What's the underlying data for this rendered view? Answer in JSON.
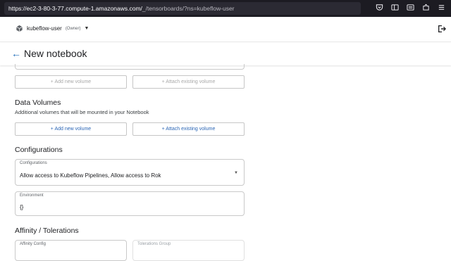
{
  "browser": {
    "url_main": "https://ec2-3-80-3-77.compute-1.amazonaws.com/",
    "url_rest": "_/tensorboards/?ns=kubeflow-user",
    "icons": [
      "pocket-icon",
      "library-icon",
      "reader-icon",
      "extensions-icon",
      "menu-icon"
    ]
  },
  "header": {
    "namespace": "kubeflow-user",
    "role": "(Owner)"
  },
  "title_bar": {
    "title": "New notebook"
  },
  "workspace_volume": {
    "add_new_label": "+ Add new volume",
    "attach_existing_label": "+ Attach existing volume"
  },
  "data_volumes": {
    "title": "Data Volumes",
    "subtitle": "Additional volumes that will be mounted in your Notebook",
    "add_new_label": "+ Add new volume",
    "attach_existing_label": "+ Attach existing volume"
  },
  "configurations": {
    "title": "Configurations",
    "select_label": "Configurations",
    "select_value": "Allow access to Kubeflow Pipelines, Allow access to Rok",
    "env_label": "Environment",
    "env_value": "{}"
  },
  "affinity": {
    "title": "Affinity / Tolerations",
    "affinity_label": "Affinity Config",
    "tolerations_label": "Tolerations Group"
  },
  "colors": {
    "accent": "#2a65b5",
    "browser_bg": "#1c1b22"
  }
}
